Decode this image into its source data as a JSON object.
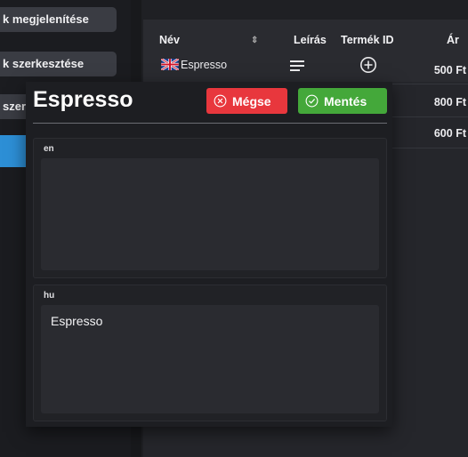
{
  "sidebar": {
    "items": [
      {
        "label": "k megjelenítése"
      },
      {
        "label": "k szerkesztése"
      },
      {
        "label": "szerk"
      }
    ]
  },
  "table": {
    "headers": {
      "name": "Név",
      "sort": "⇕",
      "description": "Leírás",
      "product_id": "Termék ID",
      "price": "Ár"
    },
    "rows": [
      {
        "name": "Espresso",
        "price": "500 Ft"
      },
      {
        "name": "",
        "price": "800 Ft"
      },
      {
        "name": "",
        "price": "600 Ft"
      }
    ]
  },
  "dialog": {
    "title": "Espresso",
    "cancel_label": "Mégse",
    "save_label": "Mentés",
    "translations": [
      {
        "lang": "en",
        "value": ""
      },
      {
        "lang": "hu",
        "value": "Espresso"
      }
    ]
  },
  "colors": {
    "cancel": "#e8373d",
    "save": "#44a83a",
    "active": "#2d8fd6"
  }
}
